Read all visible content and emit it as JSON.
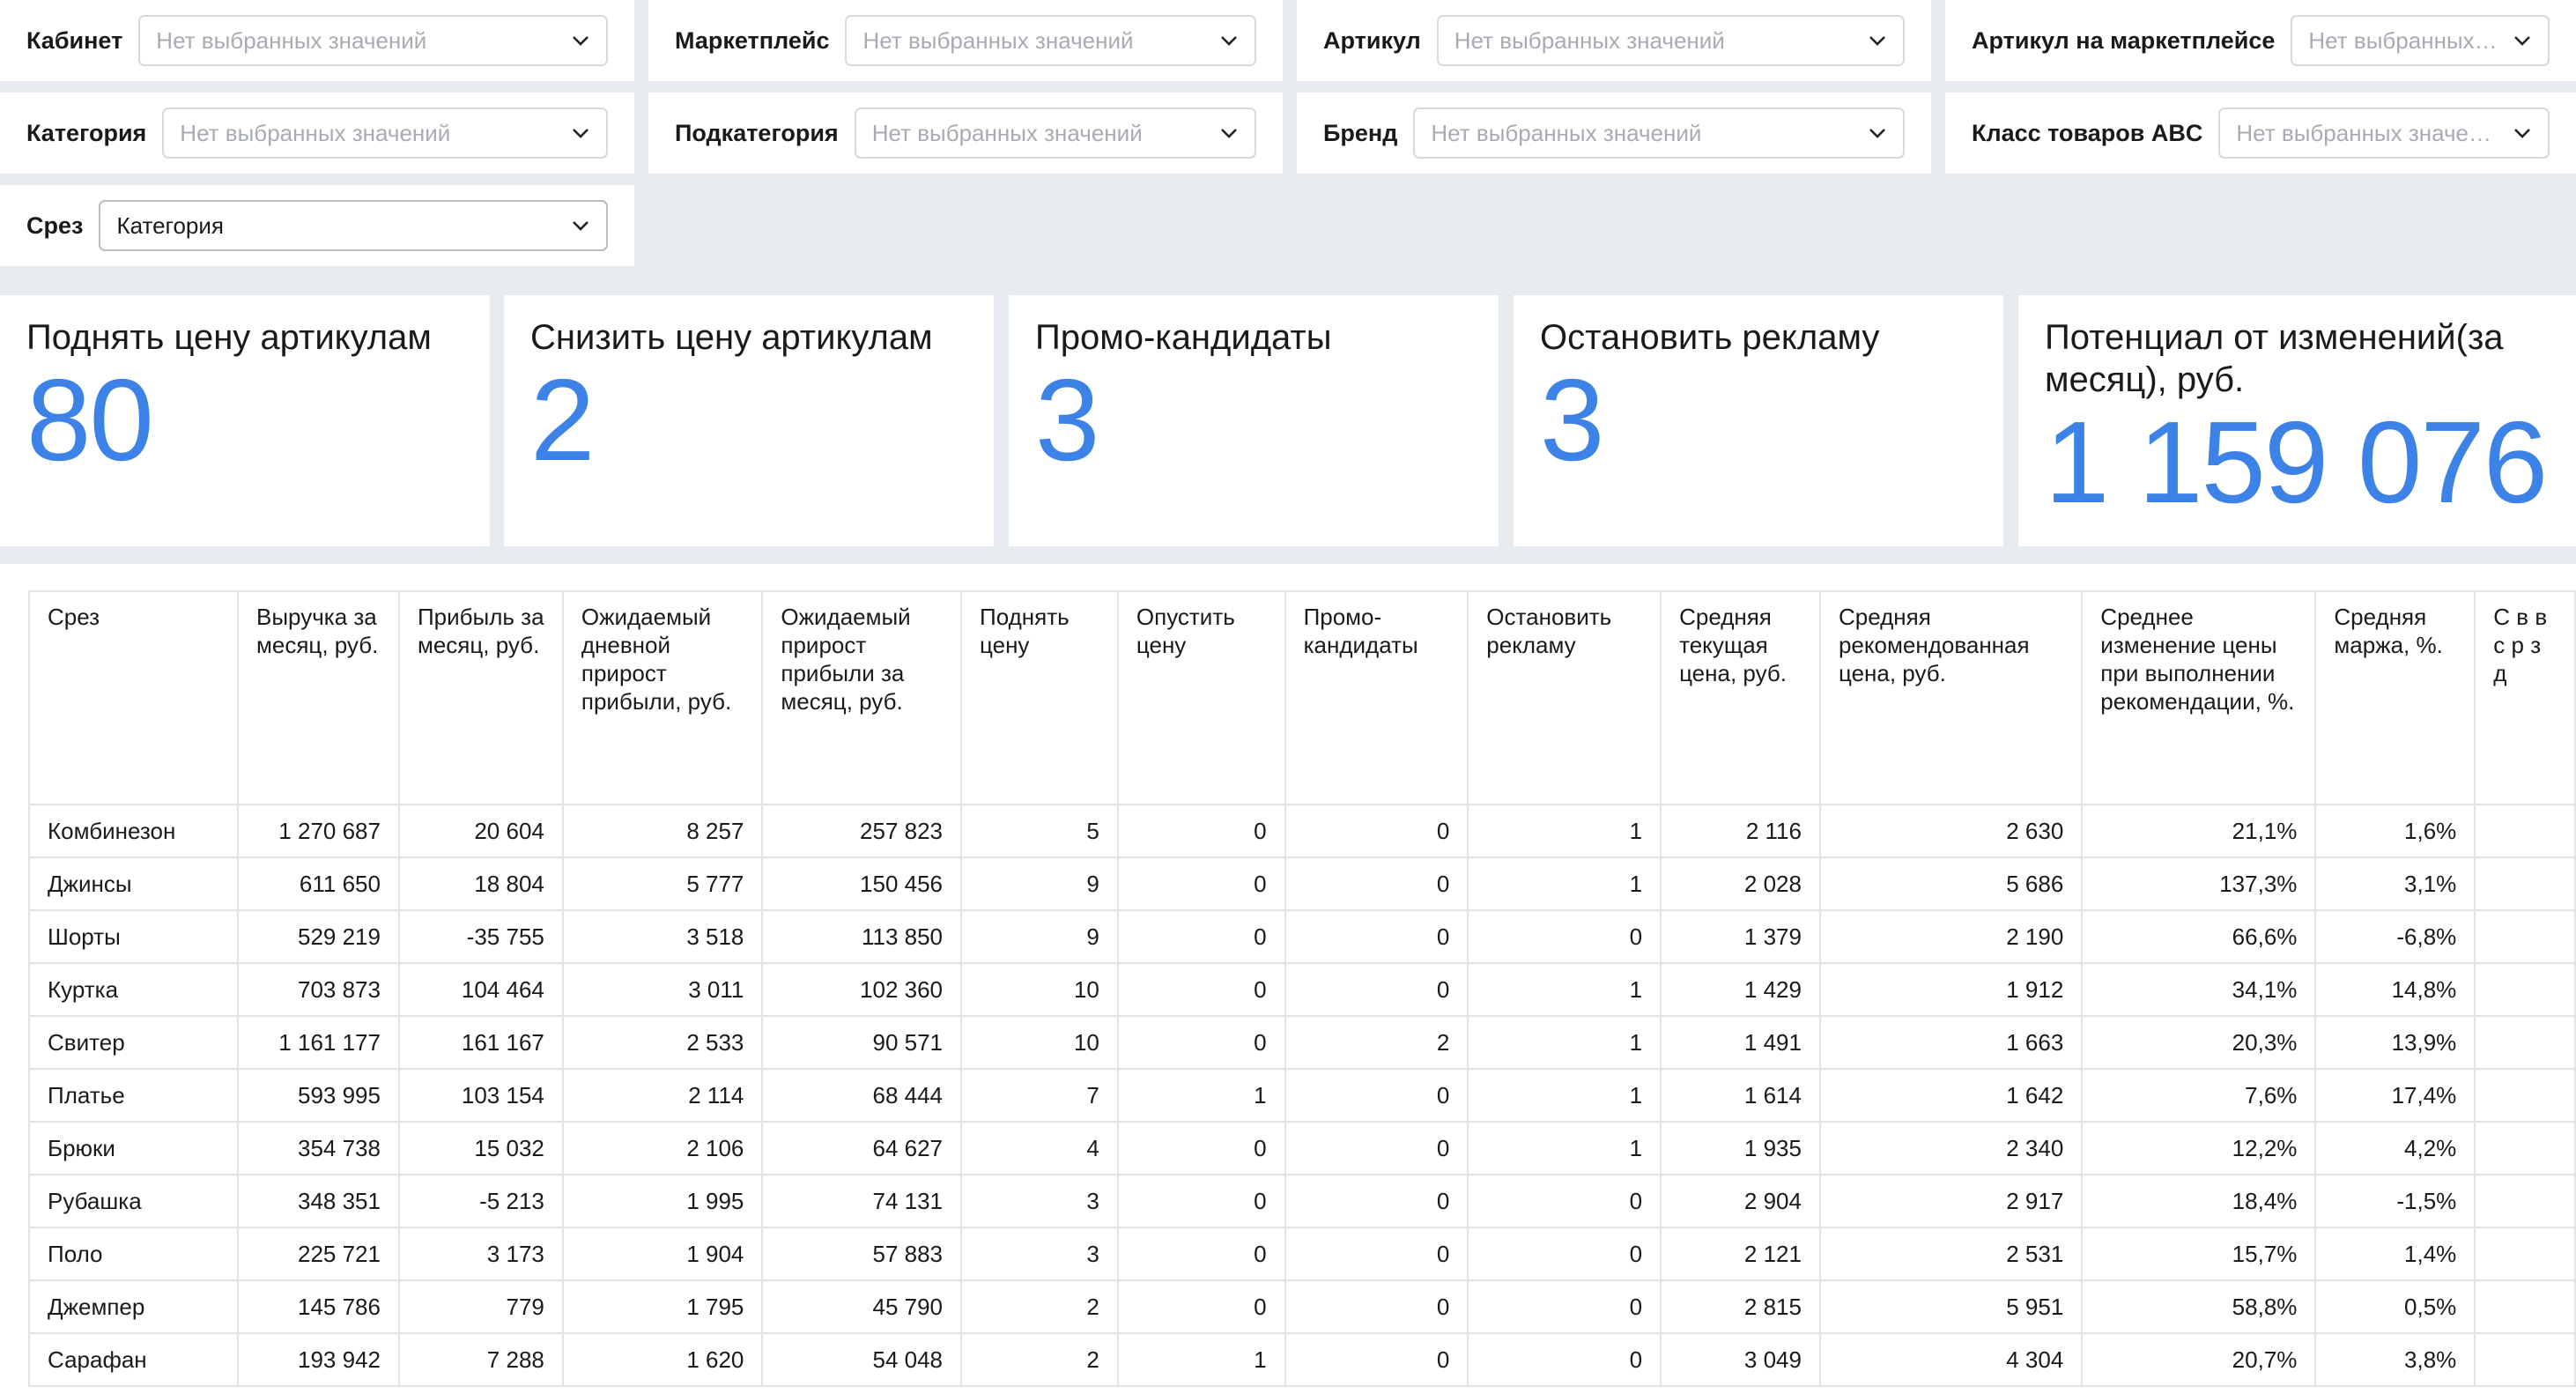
{
  "filters": {
    "row1": [
      {
        "label": "Кабинет",
        "value": "Нет выбранных значений"
      },
      {
        "label": "Маркетплейс",
        "value": "Нет выбранных значений"
      },
      {
        "label": "Артикул",
        "value": "Нет выбранных значений"
      },
      {
        "label": "Артикул на маркетплейсе",
        "value": "Нет выбранных з..."
      }
    ],
    "row2": [
      {
        "label": "Категория",
        "value": "Нет выбранных значений"
      },
      {
        "label": "Подкатегория",
        "value": "Нет выбранных значений"
      },
      {
        "label": "Бренд",
        "value": "Нет выбранных значений"
      },
      {
        "label": "Класс товаров ABC",
        "value": "Нет выбранных значений"
      }
    ],
    "slice": {
      "label": "Срез",
      "value": "Категория"
    }
  },
  "kpis": [
    {
      "title": "Поднять цену артикулам",
      "value": "80"
    },
    {
      "title": "Снизить цену артикулам",
      "value": "2"
    },
    {
      "title": "Промо-кандидаты",
      "value": "3"
    },
    {
      "title": "Остановить рекламу",
      "value": "3"
    },
    {
      "title": "Потенциал от изменений(за месяц), руб.",
      "value": "1 159 076"
    }
  ],
  "table": {
    "headers": [
      "Срез",
      "Выручка за месяц, руб.",
      "Прибыль за месяц, руб.",
      "Ожидаемый дневной прирост прибыли, руб.",
      "Ожидаемый прирост прибыли за месяц, руб.",
      "Поднять цену",
      "Опустить цену",
      "Промо-кандидаты",
      "Остановить рекламу",
      "Средняя текущая цена, руб.",
      "Средняя рекомендованная цена, руб.",
      "Среднее изменение цены при выполнении рекомендации, %.",
      "Средняя маржа, %.",
      "С в в с р з д"
    ],
    "rows": [
      [
        "Комбинезон",
        "1 270 687",
        "20 604",
        "8 257",
        "257 823",
        "5",
        "0",
        "0",
        "1",
        "2 116",
        "2 630",
        "21,1%",
        "1,6%",
        ""
      ],
      [
        "Джинсы",
        "611 650",
        "18 804",
        "5 777",
        "150 456",
        "9",
        "0",
        "0",
        "1",
        "2 028",
        "5 686",
        "137,3%",
        "3,1%",
        ""
      ],
      [
        "Шорты",
        "529 219",
        "-35 755",
        "3 518",
        "113 850",
        "9",
        "0",
        "0",
        "0",
        "1 379",
        "2 190",
        "66,6%",
        "-6,8%",
        ""
      ],
      [
        "Куртка",
        "703 873",
        "104 464",
        "3 011",
        "102 360",
        "10",
        "0",
        "0",
        "1",
        "1 429",
        "1 912",
        "34,1%",
        "14,8%",
        ""
      ],
      [
        "Свитер",
        "1 161 177",
        "161 167",
        "2 533",
        "90 571",
        "10",
        "0",
        "2",
        "1",
        "1 491",
        "1 663",
        "20,3%",
        "13,9%",
        ""
      ],
      [
        "Платье",
        "593 995",
        "103 154",
        "2 114",
        "68 444",
        "7",
        "1",
        "0",
        "1",
        "1 614",
        "1 642",
        "7,6%",
        "17,4%",
        ""
      ],
      [
        "Брюки",
        "354 738",
        "15 032",
        "2 106",
        "64 627",
        "4",
        "0",
        "0",
        "1",
        "1 935",
        "2 340",
        "12,2%",
        "4,2%",
        ""
      ],
      [
        "Рубашка",
        "348 351",
        "-5 213",
        "1 995",
        "74 131",
        "3",
        "0",
        "0",
        "0",
        "2 904",
        "2 917",
        "18,4%",
        "-1,5%",
        ""
      ],
      [
        "Поло",
        "225 721",
        "3 173",
        "1 904",
        "57 883",
        "3",
        "0",
        "0",
        "0",
        "2 121",
        "2 531",
        "15,7%",
        "1,4%",
        ""
      ],
      [
        "Джемпер",
        "145 786",
        "779",
        "1 795",
        "45 790",
        "2",
        "0",
        "0",
        "0",
        "2 815",
        "5 951",
        "58,8%",
        "0,5%",
        ""
      ],
      [
        "Сарафан",
        "193 942",
        "7 288",
        "1 620",
        "54 048",
        "2",
        "1",
        "0",
        "0",
        "3 049",
        "4 304",
        "20,7%",
        "3,8%",
        ""
      ]
    ]
  }
}
